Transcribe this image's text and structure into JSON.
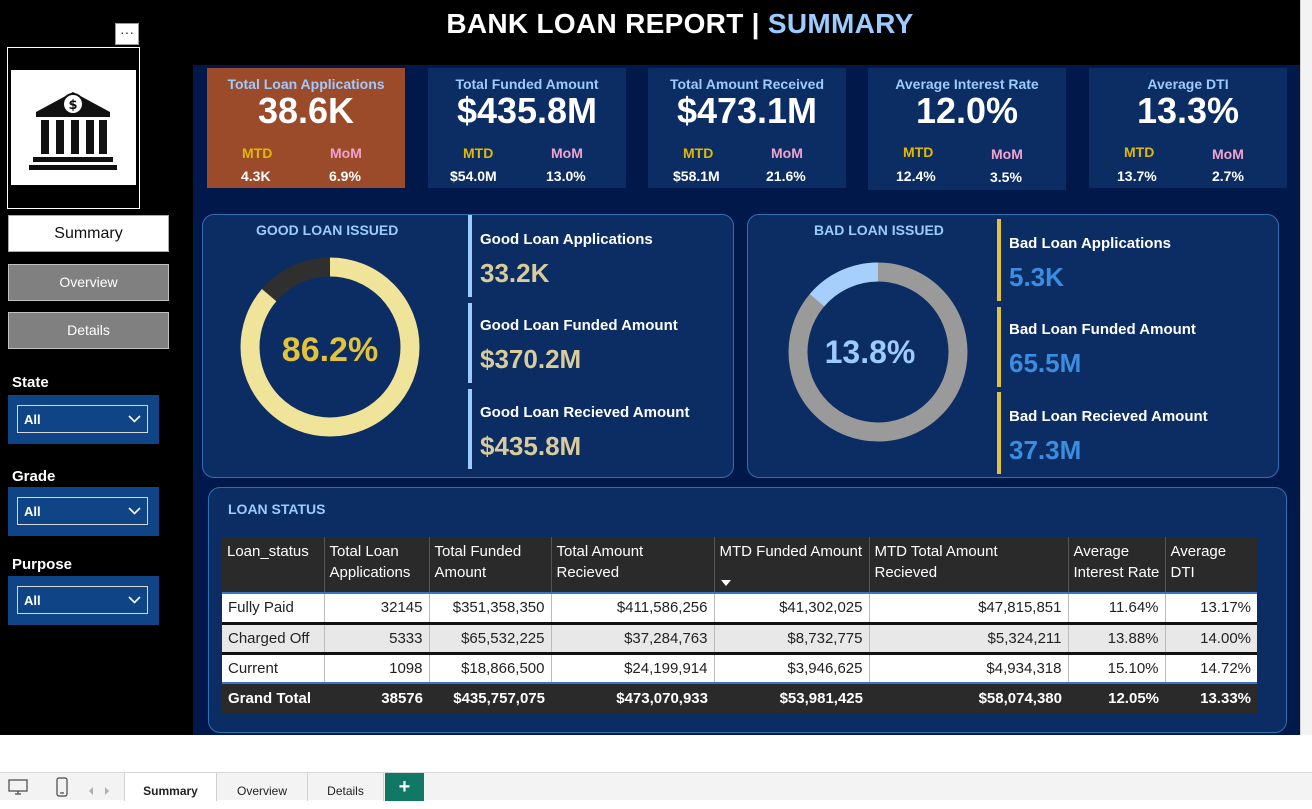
{
  "header": {
    "title_main": "BANK LOAN REPORT | ",
    "title_accent": "SUMMARY"
  },
  "sidebar": {
    "more_label": "···",
    "nav": {
      "summary": "Summary",
      "overview": "Overview",
      "details": "Details"
    },
    "slicers": [
      {
        "label": "State",
        "value": "All"
      },
      {
        "label": "Grade",
        "value": "All"
      },
      {
        "label": "Purpose",
        "value": "All"
      }
    ]
  },
  "kpis": [
    {
      "title": "Total Loan Applications",
      "value": "38.6K",
      "mtd_label": "MTD",
      "mtd": "4.3K",
      "mom_label": "MoM",
      "mom": "6.9%"
    },
    {
      "title": "Total Funded Amount",
      "value": "$435.8M",
      "mtd_label": "MTD",
      "mtd": "$54.0M",
      "mom_label": "MoM",
      "mom": "13.0%"
    },
    {
      "title": "Total Amount Received",
      "value": "$473.1M",
      "mtd_label": "MTD",
      "mtd": "$58.1M",
      "mom_label": "MoM",
      "mom": "21.6%"
    },
    {
      "title": "Average Interest Rate",
      "value": "12.0%",
      "mtd_label": "MTD",
      "mtd": "12.4%",
      "mom_label": "MoM",
      "mom": "3.5%"
    },
    {
      "title": "Average DTI",
      "value": "13.3%",
      "mtd_label": "MTD",
      "mtd": "13.7%",
      "mom_label": "MoM",
      "mom": "2.7%"
    }
  ],
  "good_loan": {
    "title": "GOOD LOAN ISSUED",
    "percent_label": "86.2%",
    "percent": 86.2,
    "applications_label": "Good Loan Applications",
    "applications": "33.2K",
    "funded_label": "Good Loan Funded Amount",
    "funded": "$370.2M",
    "received_label": "Good Loan Recieved Amount",
    "received": "$435.8M"
  },
  "bad_loan": {
    "title": "BAD LOAN ISSUED",
    "percent_label": "13.8%",
    "percent": 13.8,
    "applications_label": "Bad Loan Applications",
    "applications": "5.3K",
    "funded_label": "Bad Loan Funded Amount",
    "funded": "65.5M",
    "received_label": "Bad Loan Recieved Amount",
    "received": "37.3M"
  },
  "loan_status": {
    "title": "LOAN STATUS",
    "columns": [
      "Loan_status",
      "Total Loan Applications",
      "Total Funded Amount",
      "Total Amount Recieved",
      "MTD Funded Amount",
      "MTD Total Amount Recieved",
      "Average Interest Rate",
      "Average DTI"
    ],
    "rows": [
      [
        "Fully Paid",
        "32145",
        "$351,358,350",
        "$411,586,256",
        "$41,302,025",
        "$47,815,851",
        "11.64%",
        "13.17%"
      ],
      [
        "Charged Off",
        "5333",
        "$65,532,225",
        "$37,284,763",
        "$8,732,775",
        "$5,324,211",
        "13.88%",
        "14.00%"
      ],
      [
        "Current",
        "1098",
        "$18,866,500",
        "$24,199,914",
        "$3,946,625",
        "$4,934,318",
        "15.10%",
        "14.72%"
      ]
    ],
    "total": [
      "Grand Total",
      "38576",
      "$435,757,075",
      "$473,070,933",
      "$53,981,425",
      "$58,074,380",
      "12.05%",
      "13.33%"
    ]
  },
  "page_tabs": [
    "Summary",
    "Overview",
    "Details"
  ],
  "add_page_label": "+",
  "icons": {
    "logo": "bank-icon",
    "desktop": "desktop-icon",
    "phone": "phone-icon"
  },
  "colors": {
    "background": "#000000",
    "canvas": "#00184a",
    "card": "#0c2d63",
    "card_highlight": "#9b4a2a",
    "accent_blue": "#9ccbff",
    "mtd_yellow": "#e3b800",
    "mom_pink": "#f2a2cf",
    "good_value": "#d8cc9a",
    "good_donut": "#f0e39a",
    "bad_value": "#3b8de0",
    "bad_donut": "#a7cffb"
  }
}
